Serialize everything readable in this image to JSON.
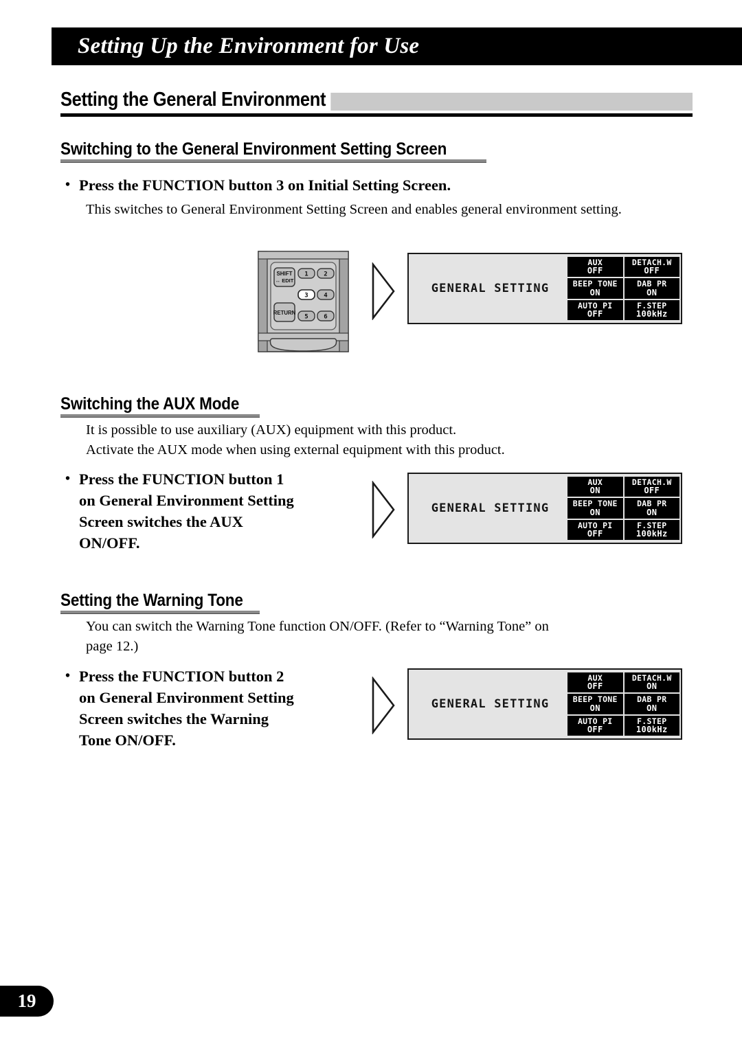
{
  "banner": {
    "title": "Setting Up the Environment for Use"
  },
  "section_heading": "Setting the General Environment",
  "subsections": [
    {
      "heading": "Switching to the General Environment Setting Screen",
      "bullet": "Press the FUNCTION button 3 on Initial Setting Screen.",
      "body": "This switches to General Environment Setting Screen and enables general environment setting."
    },
    {
      "heading": "Switching the AUX Mode",
      "body_line1": "It is possible to use auxiliary (AUX) equipment with this product.",
      "body_line2": "Activate the AUX mode when using external equipment with this product.",
      "bullet_line1": "Press the FUNCTION button 1",
      "bullet_line2": "on General Environment Setting",
      "bullet_line3": "Screen switches the AUX",
      "bullet_line4": "ON/OFF."
    },
    {
      "heading": "Setting the Warning Tone",
      "body_line1": "You can switch the Warning Tone function ON/OFF. (Refer to “Warning Tone” on",
      "body_line2": "page 12.)",
      "bullet_line1": "Press the FUNCTION button 2",
      "bullet_line2": "on General Environment Setting",
      "bullet_line3": "Screen switches the Warning",
      "bullet_line4": "Tone ON/OFF."
    }
  ],
  "remote": {
    "shift_label_line1": "SHIFT",
    "shift_label_line2": "↔ EDIT",
    "return_label": "RETURN",
    "keys": [
      "1",
      "2",
      "3",
      "4",
      "5",
      "6"
    ],
    "highlighted_key": "3"
  },
  "displays": [
    {
      "id": "display-initial",
      "title": "GENERAL SETTING",
      "cells": [
        {
          "label": "AUX",
          "value": "OFF"
        },
        {
          "label": "DETACH.W",
          "value": "OFF"
        },
        {
          "label": "BEEP TONE",
          "value": "ON"
        },
        {
          "label": "DAB PR",
          "value": "ON"
        },
        {
          "label": "AUTO PI",
          "value": "OFF"
        },
        {
          "label": "F.STEP",
          "value": "100kHz"
        }
      ]
    },
    {
      "id": "display-aux-on",
      "title": "GENERAL SETTING",
      "cells": [
        {
          "label": "AUX",
          "value": "ON"
        },
        {
          "label": "DETACH.W",
          "value": "OFF"
        },
        {
          "label": "BEEP TONE",
          "value": "ON"
        },
        {
          "label": "DAB PR",
          "value": "ON"
        },
        {
          "label": "AUTO PI",
          "value": "OFF"
        },
        {
          "label": "F.STEP",
          "value": "100kHz"
        }
      ]
    },
    {
      "id": "display-detach-on",
      "title": "GENERAL SETTING",
      "cells": [
        {
          "label": "AUX",
          "value": "OFF"
        },
        {
          "label": "DETACH.W",
          "value": "ON"
        },
        {
          "label": "BEEP TONE",
          "value": "ON"
        },
        {
          "label": "DAB PR",
          "value": "ON"
        },
        {
          "label": "AUTO PI",
          "value": "OFF"
        },
        {
          "label": "F.STEP",
          "value": "100kHz"
        }
      ]
    }
  ],
  "page_number": "19"
}
